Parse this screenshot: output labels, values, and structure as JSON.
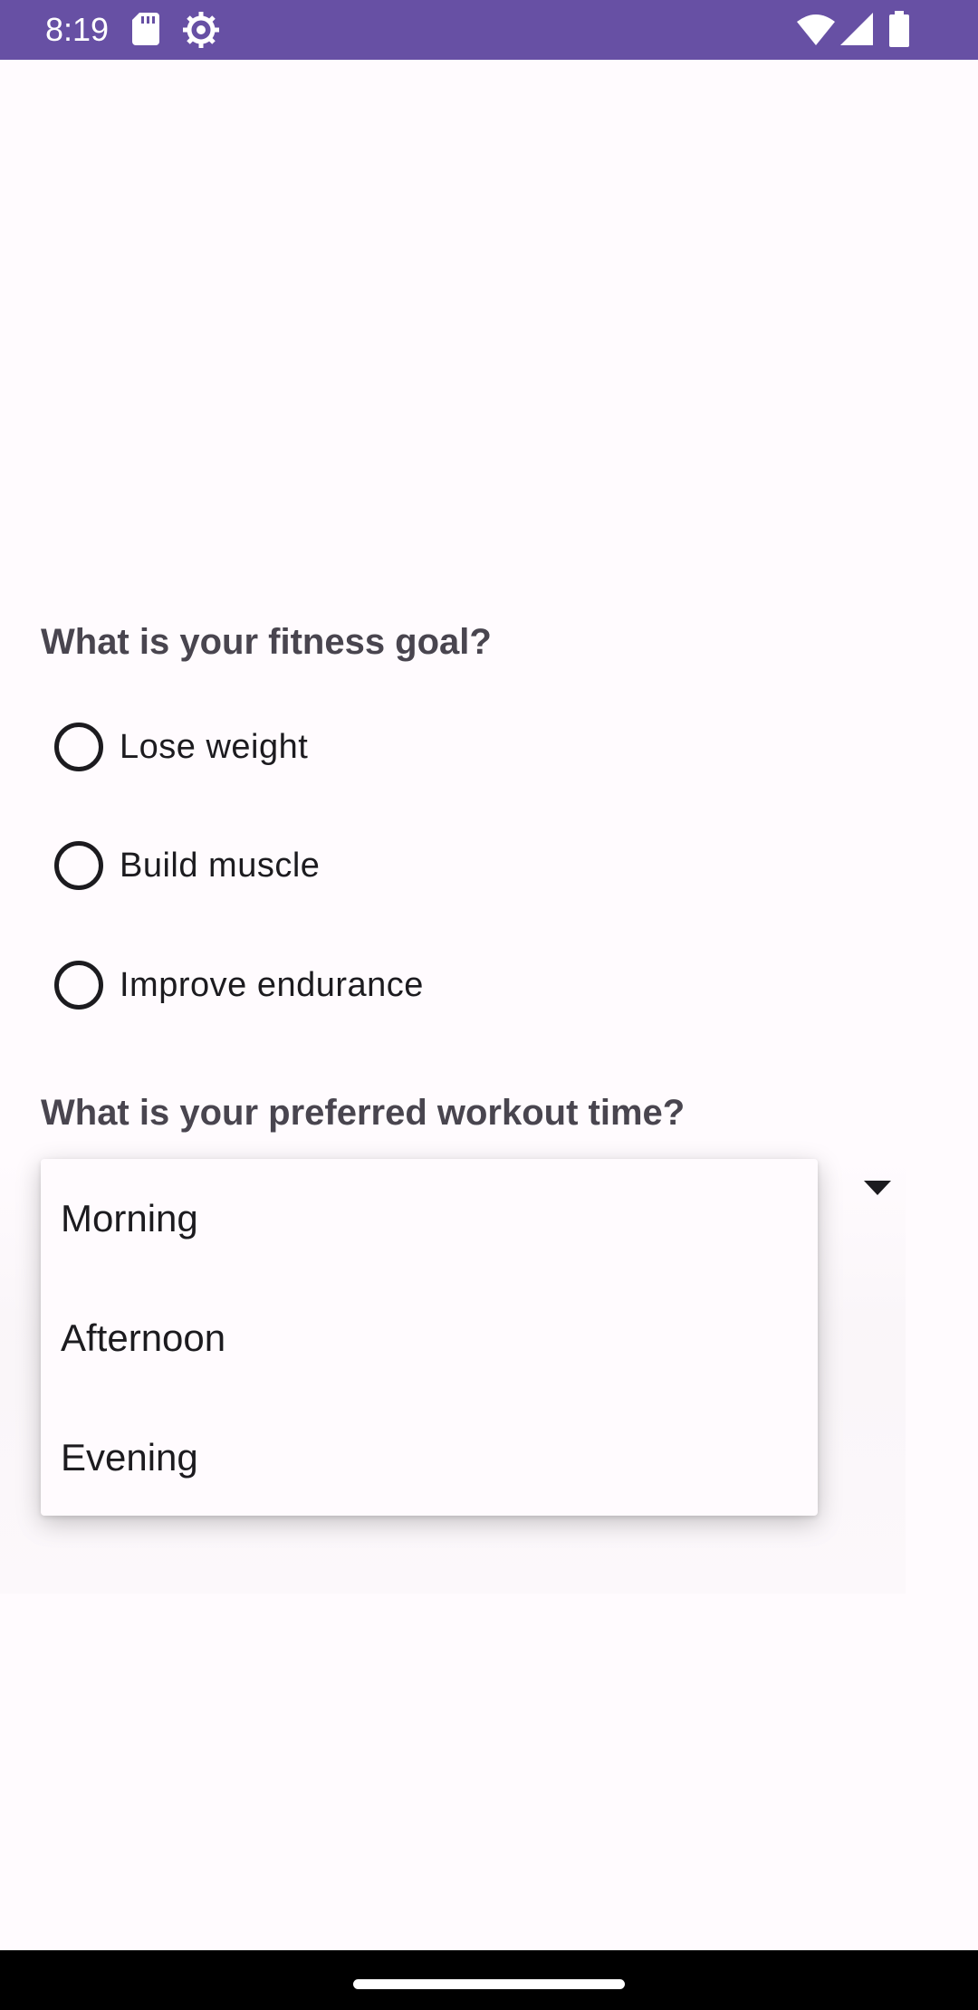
{
  "status_bar": {
    "time": "8:19",
    "background_color": "#6750A4",
    "icons": [
      "sd-card-icon",
      "settings-gear-icon",
      "wifi-icon",
      "signal-icon",
      "battery-icon"
    ]
  },
  "fitness_goal": {
    "question": "What is your fitness goal?",
    "options": [
      {
        "label": "Lose weight",
        "selected": false
      },
      {
        "label": "Build muscle",
        "selected": false
      },
      {
        "label": "Improve endurance",
        "selected": false
      }
    ]
  },
  "workout_time": {
    "question": "What is your preferred workout time?",
    "dropdown_expanded": true,
    "menu_items": [
      "Morning",
      "Afternoon",
      "Evening"
    ]
  },
  "colors": {
    "accent": "#6750A4",
    "background": "#FFFBFE",
    "question_text": "#49454F",
    "body_text": "#1C1B1F"
  }
}
